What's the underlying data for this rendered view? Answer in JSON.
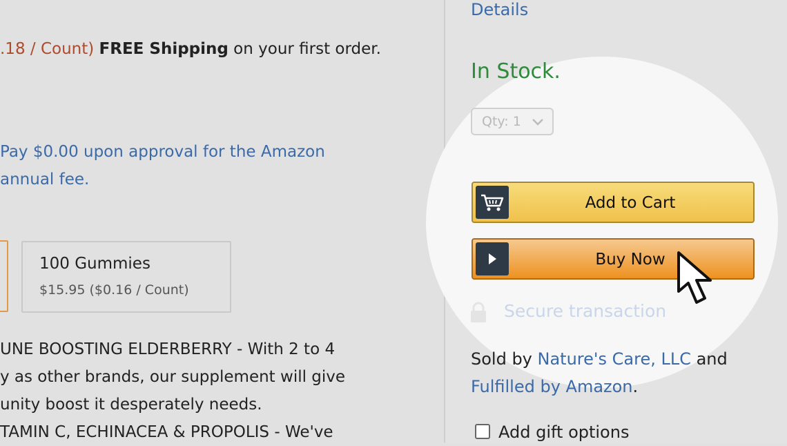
{
  "product": {
    "shipping_price_fragment": ".18 / Count)",
    "shipping_bold": "FREE Shipping",
    "shipping_rest": " on your first order.",
    "promo_line1": "Pay $0.00 upon approval for the Amazon",
    "promo_line2": "annual fee.",
    "options": [
      {
        "title": "100 Gummies",
        "price": "$15.95 ($0.16 / Count)"
      }
    ],
    "description_lines": [
      "UNE BOOSTING ELDERBERRY - With 2 to 4",
      "y as other brands, our supplement will give",
      "unity boost it desperately needs.",
      "TAMIN C, ECHINACEA & PROPOLIS - We've"
    ]
  },
  "buybox": {
    "details_link": "Details",
    "stock_status": "In Stock.",
    "quantity": "Qty: 1",
    "add_to_cart_label": "Add to Cart",
    "buy_now_label": "Buy Now",
    "secure_transaction": "Secure transaction",
    "sold_by_prefix": "Sold by ",
    "seller": "Nature's Care, LLC",
    "sold_by_and": " and",
    "fulfilled_by": "Fulfilled by Amazon",
    "fulfilled_period": ".",
    "gift_options_label": "Add gift options"
  },
  "icons": {
    "cart": "cart-icon",
    "play": "play-icon",
    "lock": "lock-icon",
    "cursor": "mouse-pointer-icon",
    "chevron": "chevron-down-icon"
  },
  "colors": {
    "add_to_cart": "#f0c14b",
    "buy_now": "#ed9220",
    "in_stock": "#2f8a3c",
    "link": "#3b6aa8"
  }
}
